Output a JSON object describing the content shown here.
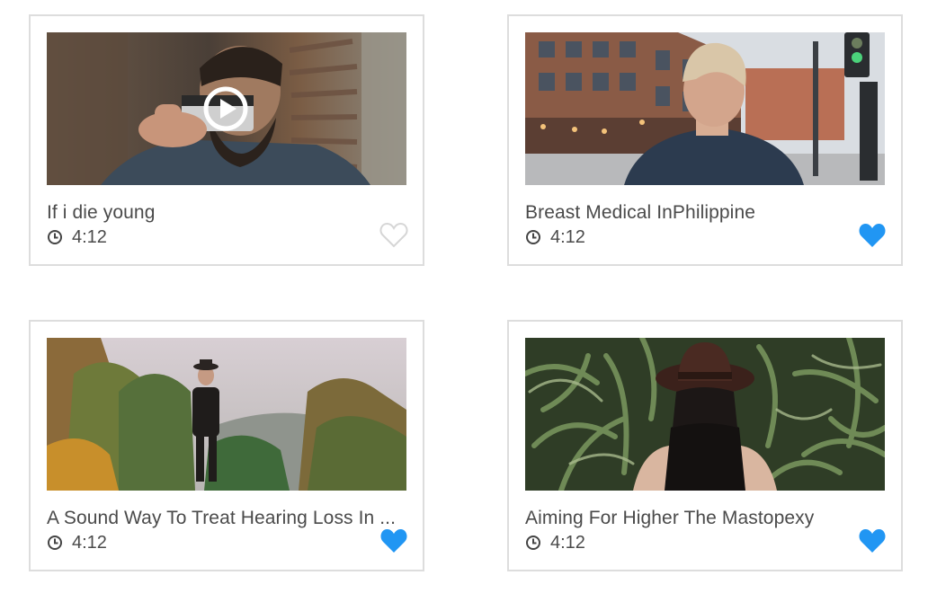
{
  "videos": [
    {
      "title": "If i die young",
      "duration": "4:12",
      "favorite": false,
      "thumbnail": "man-holding-camera",
      "has_play_button": true
    },
    {
      "title": "Breast Medical InPhilippine",
      "duration": "4:12",
      "favorite": true,
      "thumbnail": "man-on-city-street",
      "has_play_button": false
    },
    {
      "title": "A Sound Way To Treat Hearing Loss In ...",
      "duration": "4:12",
      "favorite": true,
      "thumbnail": "man-in-autumn-forest",
      "has_play_button": false
    },
    {
      "title": "Aiming For Higher The Mastopexy",
      "duration": "4:12",
      "favorite": true,
      "thumbnail": "woman-in-cornfield",
      "has_play_button": false
    }
  ],
  "colors": {
    "favorite_active": "#2196f3",
    "favorite_inactive": "#d6d6d6",
    "text": "#4a4a4a",
    "card_border": "#dddddd"
  },
  "icons": {
    "duration": "clock-icon",
    "favorite": "heart-icon",
    "play": "play-icon"
  }
}
